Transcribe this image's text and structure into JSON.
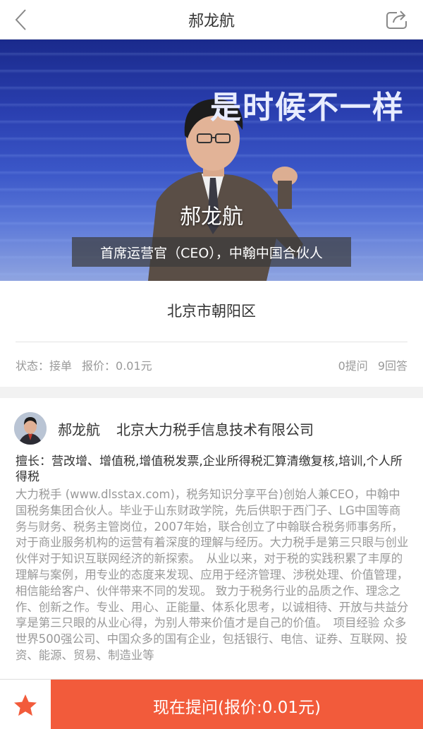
{
  "header": {
    "title": "郝龙航",
    "back_icon": "back-chevron-icon",
    "share_icon": "share-icon"
  },
  "hero": {
    "slogan": "是时候不一样",
    "name": "郝龙航",
    "title": "首席运营官（CEO），中翰中国合伙人"
  },
  "location": "北京市朝阳区",
  "status": {
    "state": "状态：接单",
    "price": "报价：0.01元",
    "questions": "0提问",
    "answers": "9回答"
  },
  "expert": {
    "name": "郝龙航",
    "company": "北京大力税手信息技术有限公司",
    "specialty": "擅长：营改增、增值税,增值税发票,企业所得税汇算清缴复核,培训,个人所得税",
    "bio": "大力税手 (www.dlsstax.com)，税务知识分享平台)创始人兼CEO，中翰中国税务集团合伙人。毕业于山东财政学院，先后供职于西门子、LG中国等商务与财务、税务主管岗位，2007年始，联合创立了中翰联合税务师事务所，对于商业服务机构的运营有着深度的理解与经历。大力税手是第三只眼与创业伙伴对于知识互联网经济的新探索。　从业以来，对于税的实践积累了丰厚的理解与案例，用专业的态度来发现、应用于经济管理、涉税处理、价值管理，相信能给客户、伙伴带来不同的发现。 致力于税务行业的品质之作、理念之作、创新之作。专业、用心、正能量、体系化思考，以诚相待、开放与共益分享是第三只眼的从业心得，为别人带来价值才是自己的价值。　项目经验 众多世界500强公司、中国众多的国有企业，包括银行、电信、证券、互联网、投资、能源、贸易、制造业等"
  },
  "bottom": {
    "ask_label": "现在提问(报价:0.01元)",
    "favorite_icon": "star-icon"
  },
  "colors": {
    "accent": "#f25b3b",
    "muted_text": "#999999"
  }
}
